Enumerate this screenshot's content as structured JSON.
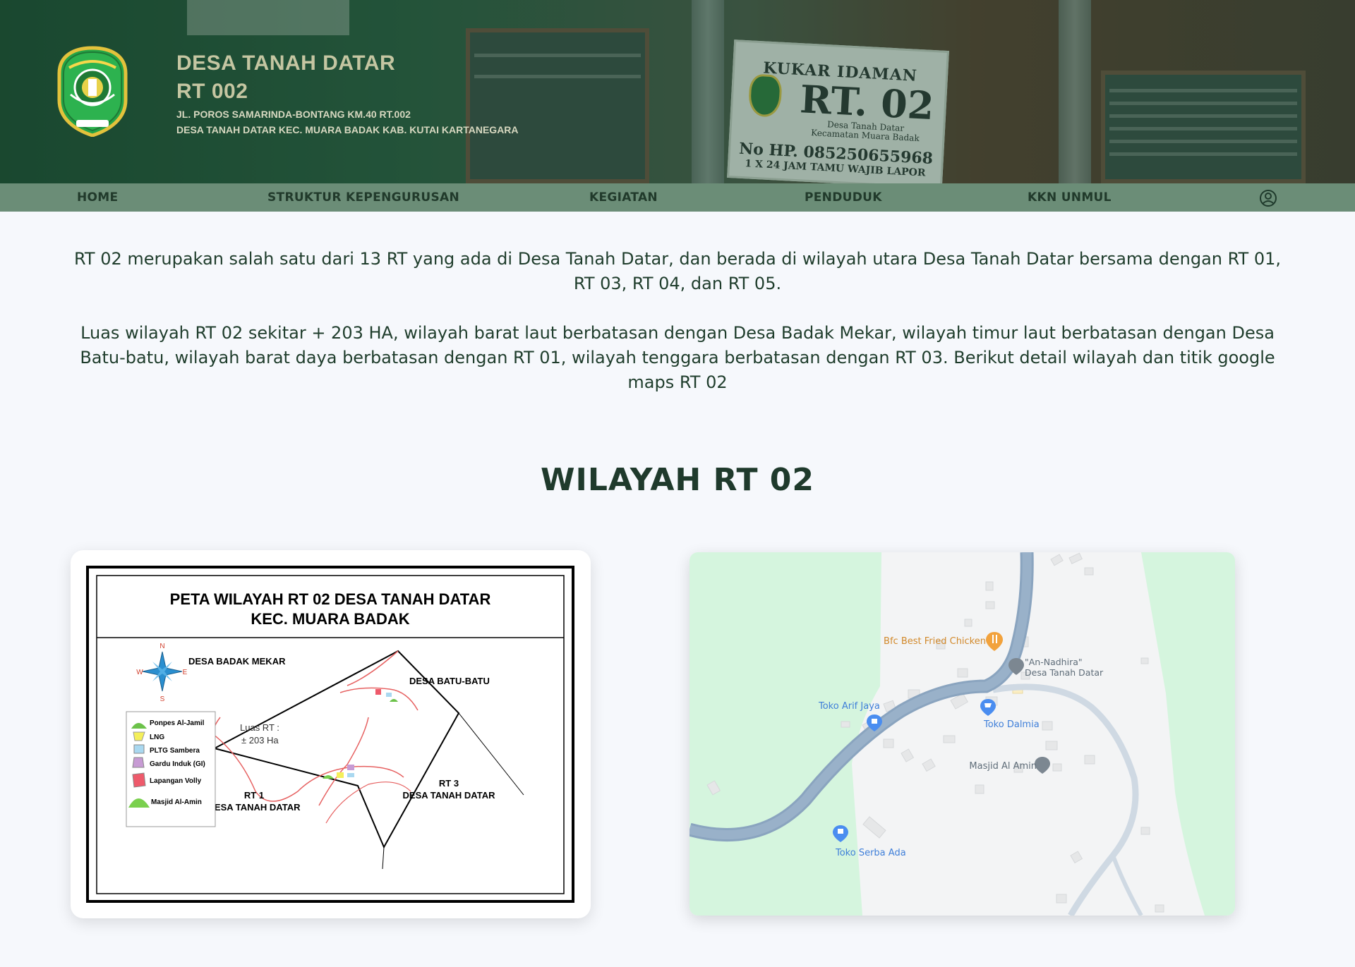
{
  "header": {
    "title_line1": "DESA TANAH DATAR",
    "title_line2": "RT 002",
    "address_line1": "JL. POROS SAMARINDA-BONTANG KM.40 RT.002",
    "address_line2": "DESA TANAH DATAR KEC. MUARA BADAK KAB. KUTAI KARTANEGARA",
    "logo_icon": "regency-emblem-icon",
    "sign": {
      "line1": "KUKAR IDAMAN",
      "line2": "RT. 02",
      "line3": "Desa Tanah Datar",
      "line4": "Kecamatan Muara Badak",
      "line5": "No HP. 085250655968",
      "line6": "1 X 24 JAM TAMU WAJIB LAPOR"
    }
  },
  "nav": {
    "items": [
      {
        "label": "HOME"
      },
      {
        "label": "STRUKTUR KEPENGURUSAN"
      },
      {
        "label": "KEGIATAN"
      },
      {
        "label": "PENDUDUK"
      },
      {
        "label": "KKN UNMUL"
      }
    ],
    "user_icon": "user-circle-icon"
  },
  "content": {
    "paragraph1": "RT 02 merupakan salah satu dari 13 RT yang ada di Desa Tanah Datar, dan berada di wilayah utara Desa Tanah Datar bersama dengan RT 01, RT 03, RT 04, dan RT 05.",
    "paragraph2": "Luas wilayah RT 02 sekitar + 203 HA, wilayah barat laut berbatasan dengan Desa Badak Mekar, wilayah timur laut berbatasan dengan Desa Batu-batu, wilayah barat daya berbatasan dengan RT 01, wilayah tenggara berbatasan dengan RT 03. Berikut detail wilayah dan titik google maps RT 02",
    "section_title": "WILAYAH RT 02"
  },
  "region_map": {
    "title_line1": "PETA WILAYAH RT 02 DESA TANAH DATAR",
    "title_line2": "KEC. MUARA BADAK",
    "compass": {
      "n": "N",
      "e": "E",
      "s": "S",
      "w": "W"
    },
    "labels": {
      "badak_mekar": "DESA BADAK MEKAR",
      "batu_batu": "DESA BATU-BATU",
      "luas_line1": "Luas RT :",
      "luas_line2": "± 203 Ha",
      "rt1_line1": "RT 1",
      "rt1_line2": "DESA TANAH DATAR",
      "rt3_line1": "RT 3",
      "rt3_line2": "DESA TANAH DATAR"
    },
    "legend": [
      {
        "label": "Ponpes Al-Jamil",
        "color": "#6cc24a"
      },
      {
        "label": "LNG",
        "color": "#f4ef5a"
      },
      {
        "label": "PLTG Sambera",
        "color": "#a9d8f0"
      },
      {
        "label": "Gardu Induk (GI)",
        "color": "#c79bd4"
      },
      {
        "label": "Lapangan Volly",
        "color": "#ee5a6b"
      },
      {
        "label": "Masjid Al-Amin",
        "color": "#7ad04e"
      }
    ]
  },
  "google_map": {
    "places": [
      {
        "label": "Bfc Best Fried Chicken",
        "icon": "restaurant-pin-icon",
        "color": "#e8a14a"
      },
      {
        "label": "\"An-Nadhira\"",
        "icon": "mosque-pin-icon",
        "color": "#7b8794"
      },
      {
        "label": "Desa Tanah Datar",
        "icon": "",
        "color": "#7b8794"
      },
      {
        "label": "Toko Arif Jaya",
        "icon": "shopping-pin-icon",
        "color": "#4a8df0"
      },
      {
        "label": "Toko Dalmia",
        "icon": "cart-pin-icon",
        "color": "#4a8df0"
      },
      {
        "label": "Masjid Al Amin",
        "icon": "mosque-pin-icon",
        "color": "#7b8794"
      },
      {
        "label": "Toko Serba Ada",
        "icon": "shopping-pin-icon",
        "color": "#4a8df0"
      }
    ]
  }
}
